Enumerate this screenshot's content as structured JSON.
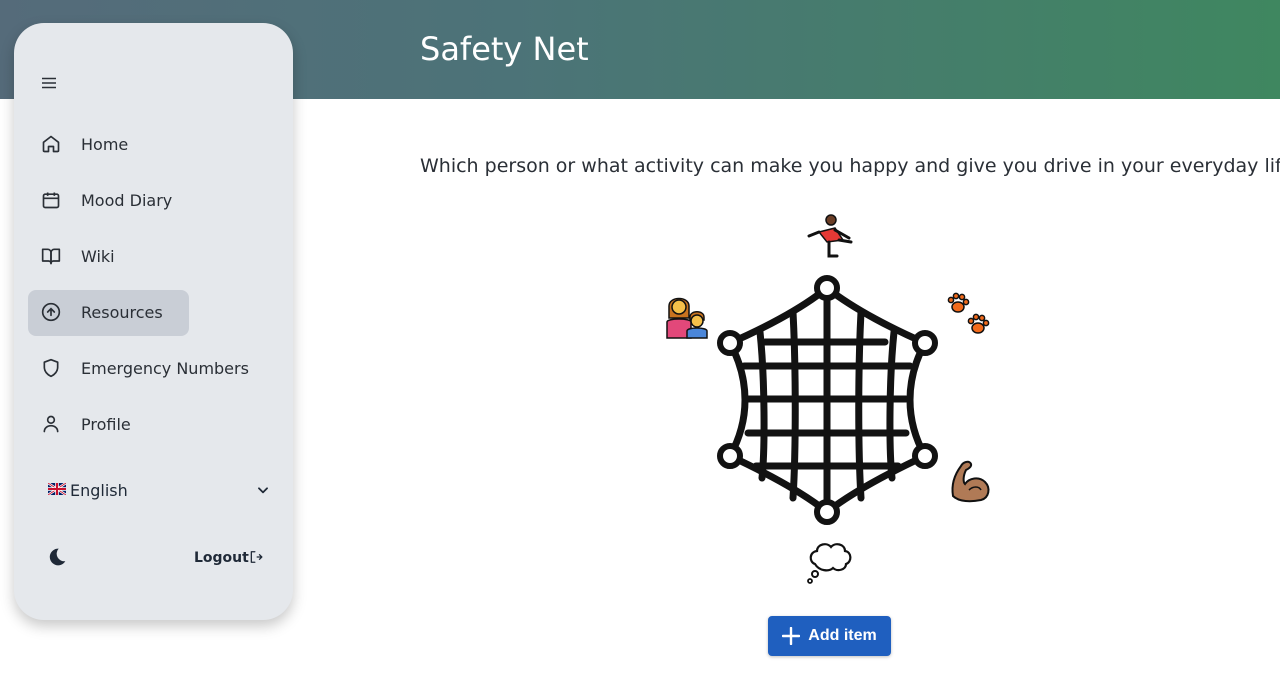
{
  "header": {
    "title": "Safety Net",
    "color_start": "#556b7a",
    "color_end": "#3f8760"
  },
  "sidebar": {
    "menu_icon": "hamburger-icon",
    "items": [
      {
        "label": "Home",
        "icon": "home-icon",
        "active": false
      },
      {
        "label": "Mood Diary",
        "icon": "calendar-icon",
        "active": false
      },
      {
        "label": "Wiki",
        "icon": "book-icon",
        "active": false
      },
      {
        "label": "Resources",
        "icon": "arrow-up-circle-icon",
        "active": true
      },
      {
        "label": "Emergency Numbers",
        "icon": "shield-icon",
        "active": false
      },
      {
        "label": "Profile",
        "icon": "user-icon",
        "active": false
      }
    ],
    "language": {
      "selected": "English",
      "flag_icon": "uk-flag-icon"
    },
    "theme_icon": "moon-icon",
    "logout_label": "Logout",
    "logout_icon": "logout-icon"
  },
  "main": {
    "question": "Which person or what activity can make you happy and give you drive in your everyday life?",
    "net_icon": "safety-net-icon",
    "items": [
      {
        "icon": "person-running-icon",
        "position": "top"
      },
      {
        "icon": "paw-prints-icon",
        "position": "upper-right"
      },
      {
        "icon": "flexed-biceps-icon",
        "position": "lower-right"
      },
      {
        "icon": "thought-balloon-icon",
        "position": "bottom"
      },
      {
        "icon": "family-icon",
        "position": "upper-left"
      }
    ],
    "add_button_label": "Add item"
  },
  "colors": {
    "accent": "#1f5fbf",
    "active_nav": "#c9ced6",
    "sidebar_bg": "#e5e8ec"
  }
}
